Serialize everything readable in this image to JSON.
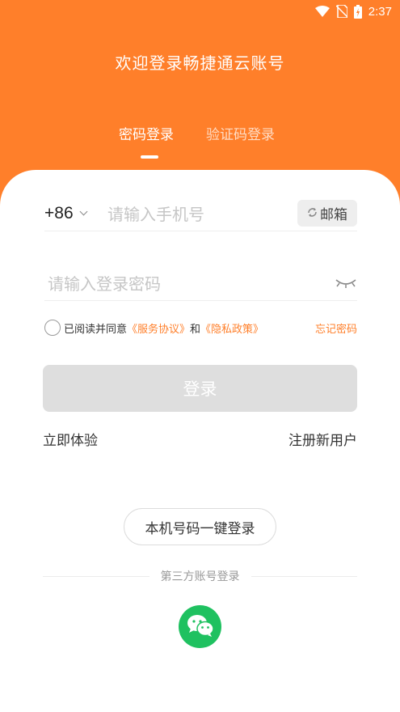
{
  "status_bar": {
    "time": "2:37"
  },
  "header": {
    "title": "欢迎登录畅捷通云账号"
  },
  "tabs": [
    {
      "label": "密码登录",
      "active": true
    },
    {
      "label": "验证码登录",
      "active": false
    }
  ],
  "form": {
    "country_code": "+86",
    "phone_placeholder": "请输入手机号",
    "email_label": "邮箱",
    "password_placeholder": "请输入登录密码"
  },
  "agreement": {
    "prefix": "已阅读并同意",
    "service_link": "《服务协议》",
    "and": "和",
    "privacy_link": "《隐私政策》",
    "forgot": "忘记密码"
  },
  "login_button": "登录",
  "quick": {
    "try_now": "立即体验",
    "register": "注册新用户"
  },
  "one_key_login": "本机号码一键登录",
  "third_party": {
    "label": "第三方账号登录"
  },
  "colors": {
    "accent": "#ff7f2a",
    "wechat": "#1fc160",
    "disabled_button": "#dedede"
  }
}
